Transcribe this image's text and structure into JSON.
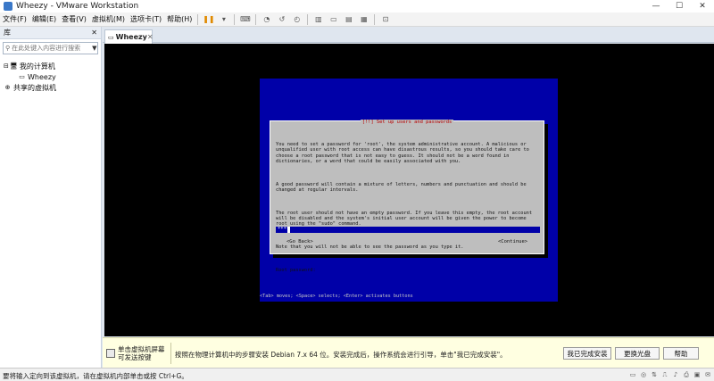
{
  "window": {
    "title": "Wheezy - VMware Workstation",
    "controls": {
      "minimize": "—",
      "maximize": "☐",
      "close": "✕"
    }
  },
  "menu": {
    "items": [
      "文件(F)",
      "编辑(E)",
      "查看(V)",
      "虚拟机(M)",
      "选项卡(T)",
      "帮助(H)"
    ]
  },
  "toolbar": {
    "icons": [
      "pause-icon",
      "dropdown-icon",
      "send-keys-icon",
      "snapshot-icon",
      "revert-snapshot-icon",
      "snapshot-manager-icon",
      "sidebar-toggle-icon",
      "fullscreen-icon",
      "unity-icon",
      "thumbnail-icon",
      "console-view-icon"
    ]
  },
  "sidebar": {
    "header": "库",
    "close_glyph": "✕",
    "search": {
      "placeholder": "在此处键入内容进行搜索",
      "value": ""
    },
    "tree": [
      {
        "label": "我的计算机",
        "expander": "⊟",
        "icon": "computer-icon"
      },
      {
        "label": "Wheezy",
        "icon": "vm-icon"
      },
      {
        "label": "共享的虚拟机",
        "icon": "shared-vm-icon"
      }
    ]
  },
  "tabs": [
    {
      "label": "Wheezy",
      "close": "✕"
    }
  ],
  "guest": {
    "dialog_title": "[!!] Set up users and passwords",
    "paragraphs": [
      "You need to set a password for 'root', the system administrative account. A malicious or unqualified user with root access can have disastrous results, so you should take care to choose a root password that is not easy to guess. It should not be a word found in dictionaries, or a word that could be easily associated with you.",
      "A good password will contain a mixture of letters, numbers and punctuation and should be changed at regular intervals.",
      "The root user should not have an empty password. If you leave this empty, the root account will be disabled and the system's initial user account will be given the power to become root using the \"sudo\" command.",
      "Note that you will not be able to see the password as you type it."
    ],
    "prompt": "Root password:",
    "password_value": "****",
    "go_back": "<Go Back>",
    "continue": "<Continue>",
    "hint": "<Tab> moves; <Space> selects; <Enter> activates buttons"
  },
  "infobar": {
    "left_line1": "单击虚拟机屏幕",
    "left_line2": "可发送按键",
    "message": "按照在物理计算机中的步骤安装 Debian 7.x 64 位。安装完成后，操作系统会进行引导，单击\"我已完成安装\"。",
    "btn_done": "我已完成安装",
    "btn_change_disc": "更换光盘",
    "btn_help": "帮助"
  },
  "status": {
    "text": "要将输入定向到该虚拟机，请在虚拟机内部单击或按 Ctrl+G。",
    "icons": [
      "hdd-icon",
      "cdrom-icon",
      "network-icon",
      "usb-icon",
      "sound-icon",
      "printer-icon",
      "display-icon",
      "message-icon"
    ]
  }
}
